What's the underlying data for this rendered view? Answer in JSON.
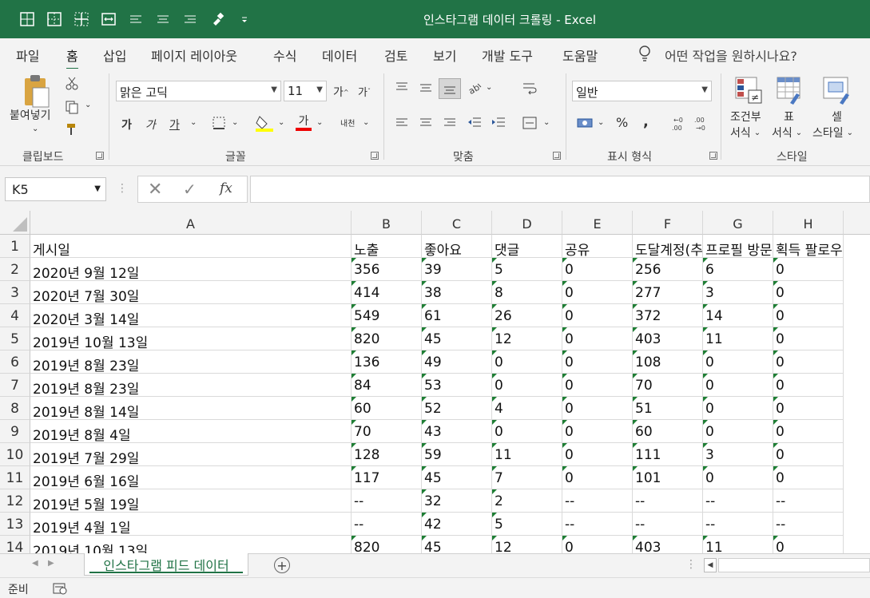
{
  "window": {
    "title": "인스타그램 데이터 크롤링  -  Excel"
  },
  "menu": {
    "tabs": [
      "파일",
      "홈",
      "삽입",
      "페이지 레이아웃",
      "수식",
      "데이터",
      "검토",
      "보기",
      "개발 도구",
      "도움말"
    ],
    "active_tab": "홈",
    "search_placeholder": "어떤 작업을 원하시나요?"
  },
  "ribbon": {
    "clipboard": {
      "label": "클립보드",
      "paste": "붙여넣기"
    },
    "font": {
      "label": "글꼴",
      "font_name": "맑은 고딕",
      "font_size": "11",
      "bold": "가",
      "italic": "가",
      "underline": "가",
      "font_color_glyph": "가",
      "grow": "가",
      "shrink": "가",
      "phonetic": "내천"
    },
    "alignment": {
      "label": "맞춤"
    },
    "number": {
      "label": "표시 형식",
      "format": "일반"
    },
    "styles": {
      "label": "스타일",
      "conditional_line1": "조건부",
      "conditional_line2": "서식",
      "table_line1": "표",
      "table_line2": "서식",
      "cell_line1": "셀",
      "cell_line2": "스타일"
    }
  },
  "formula_bar": {
    "name_box": "K5",
    "formula": ""
  },
  "sheet": {
    "columns": [
      "A",
      "B",
      "C",
      "D",
      "E",
      "F",
      "G",
      "H"
    ],
    "header_row": [
      "게시일",
      "노출",
      "좋아요",
      "댓글",
      "공유",
      "도달계정(추",
      "프로필 방문",
      "획득 팔로우"
    ],
    "rows": [
      {
        "num": "2",
        "cells": [
          "2020년 9월 12일",
          "356",
          "39",
          "5",
          "0",
          "256",
          "6",
          "0"
        ]
      },
      {
        "num": "3",
        "cells": [
          "2020년 7월 30일",
          "414",
          "38",
          "8",
          "0",
          "277",
          "3",
          "0"
        ]
      },
      {
        "num": "4",
        "cells": [
          "2020년 3월 14일",
          "549",
          "61",
          "26",
          "0",
          "372",
          "14",
          "0"
        ]
      },
      {
        "num": "5",
        "cells": [
          "2019년 10월 13일",
          "820",
          "45",
          "12",
          "0",
          "403",
          "11",
          "0"
        ]
      },
      {
        "num": "6",
        "cells": [
          "2019년 8월 23일",
          "136",
          "49",
          "0",
          "0",
          "108",
          "0",
          "0"
        ]
      },
      {
        "num": "7",
        "cells": [
          "2019년 8월 23일",
          "84",
          "53",
          "0",
          "0",
          "70",
          "0",
          "0"
        ]
      },
      {
        "num": "8",
        "cells": [
          "2019년 8월 14일",
          "60",
          "52",
          "4",
          "0",
          "51",
          "0",
          "0"
        ]
      },
      {
        "num": "9",
        "cells": [
          "2019년 8월 4일",
          "70",
          "43",
          "0",
          "0",
          "60",
          "0",
          "0"
        ]
      },
      {
        "num": "10",
        "cells": [
          "2019년 7월 29일",
          "128",
          "59",
          "11",
          "0",
          "111",
          "3",
          "0"
        ]
      },
      {
        "num": "11",
        "cells": [
          "2019년 6월 16일",
          "117",
          "45",
          "7",
          "0",
          "101",
          "0",
          "0"
        ]
      },
      {
        "num": "12",
        "cells": [
          "2019년 5월 19일",
          "--",
          "32",
          "2",
          "--",
          "--",
          "--",
          "--"
        ]
      },
      {
        "num": "13",
        "cells": [
          "2019년 4월 1일",
          "--",
          "42",
          "5",
          "--",
          "--",
          "--",
          "--"
        ]
      },
      {
        "num": "14",
        "cells": [
          "2019년 10월 13일",
          "820",
          "45",
          "12",
          "0",
          "403",
          "11",
          "0"
        ]
      }
    ],
    "tab_name": "인스타그램 피드 데이터"
  },
  "status": {
    "ready": "준비"
  },
  "colors": {
    "accent": "#217346",
    "green_triangle": "#1e7e34"
  }
}
